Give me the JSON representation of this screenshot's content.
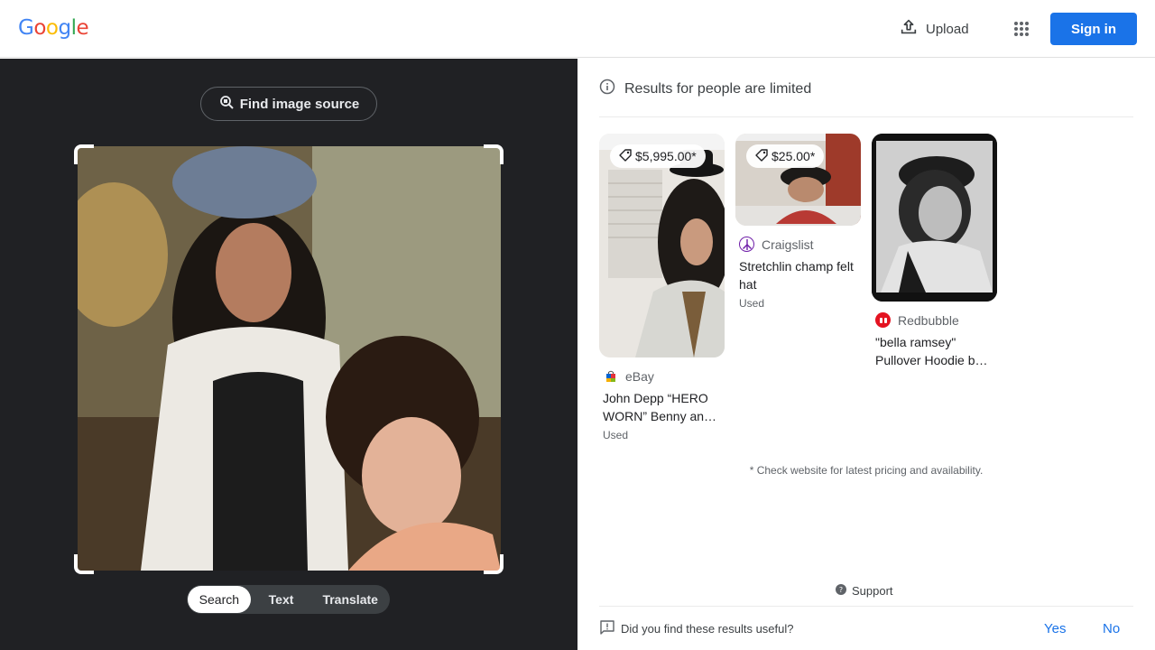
{
  "header": {
    "logo_text": "Google",
    "upload_label": "Upload",
    "signin_label": "Sign in",
    "apps_icon": "apps-grid-icon",
    "accent": "#1a73e8"
  },
  "left_panel": {
    "find_source_label": "Find image source",
    "modes": [
      "Search",
      "Text",
      "Translate"
    ],
    "active_mode": "Search"
  },
  "results": {
    "notice": "Results for people are limited",
    "cards": [
      {
        "price": "$5,995.00*",
        "source": "eBay",
        "title": "John Depp “HERO WORN” Benny an…",
        "condition": "Used"
      },
      {
        "price": "$25.00*",
        "source": "Craigslist",
        "title": "Stretchlin champ felt hat",
        "condition": "Used"
      },
      {
        "source": "Redbubble",
        "title": "\"bella ramsey\" Pullover Hoodie b…"
      }
    ],
    "pricing_note": "* Check website for latest pricing and availability.",
    "support_label": "Support",
    "feedback_question": "Did you find these results useful?",
    "yes_label": "Yes",
    "no_label": "No"
  }
}
